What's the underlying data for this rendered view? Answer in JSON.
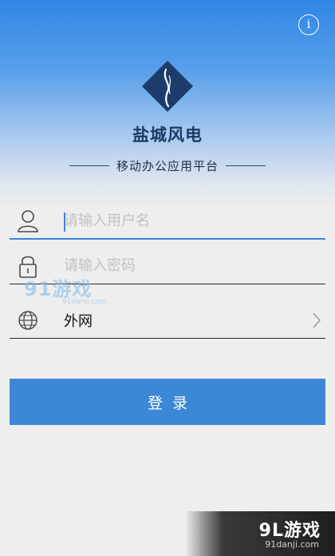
{
  "header": {
    "info_icon": "info-icon",
    "info_label": "i",
    "logo_icon": "wind-logo-icon",
    "app_title": "盐城风电",
    "subtitle": "移动办公应用平台"
  },
  "login_form": {
    "username": {
      "icon": "user-icon",
      "placeholder": "请输入用户名",
      "value": ""
    },
    "password": {
      "icon": "lock-icon",
      "placeholder": "请输入密码",
      "value": ""
    },
    "network": {
      "icon": "globe-icon",
      "value": "外网",
      "chevron_icon": "chevron-right-icon"
    },
    "login_button": "登录"
  },
  "watermarks": {
    "middle_main": "91游戏",
    "middle_sub": "91danji.com",
    "corner_main": "9L游戏",
    "corner_sub": "91danji.com"
  },
  "colors": {
    "accent": "#3d88d6",
    "title": "#1b3a63",
    "logo": "#1d3c6b"
  }
}
